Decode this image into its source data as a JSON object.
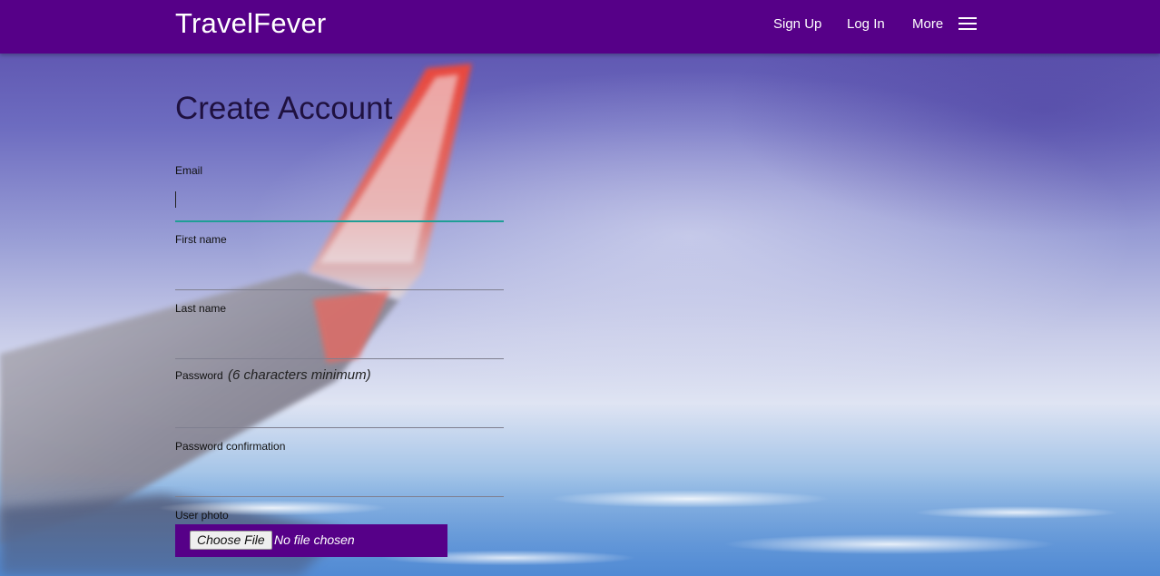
{
  "navbar": {
    "brand": "TravelFever",
    "links": {
      "sign_up": "Sign Up",
      "log_in": "Log In",
      "more": "More"
    },
    "menu_icon": "hamburger-menu-icon",
    "background_color": "#560088"
  },
  "form": {
    "title": "Create Account",
    "fields": {
      "email": {
        "label": "Email",
        "value": "",
        "focused": true
      },
      "first_name": {
        "label": "First name",
        "value": ""
      },
      "last_name": {
        "label": "Last name",
        "value": ""
      },
      "password": {
        "label": "Password",
        "hint": "(6 characters minimum)",
        "value": ""
      },
      "password_confirmation": {
        "label": "Password confirmation",
        "value": ""
      }
    },
    "user_photo": {
      "label": "User photo",
      "button_label": "Choose File",
      "status": "No file chosen"
    }
  },
  "colors": {
    "accent": "#560088",
    "focus_underline": "#1f9e96"
  },
  "background": {
    "image": "airplane-wing-over-clouds"
  }
}
